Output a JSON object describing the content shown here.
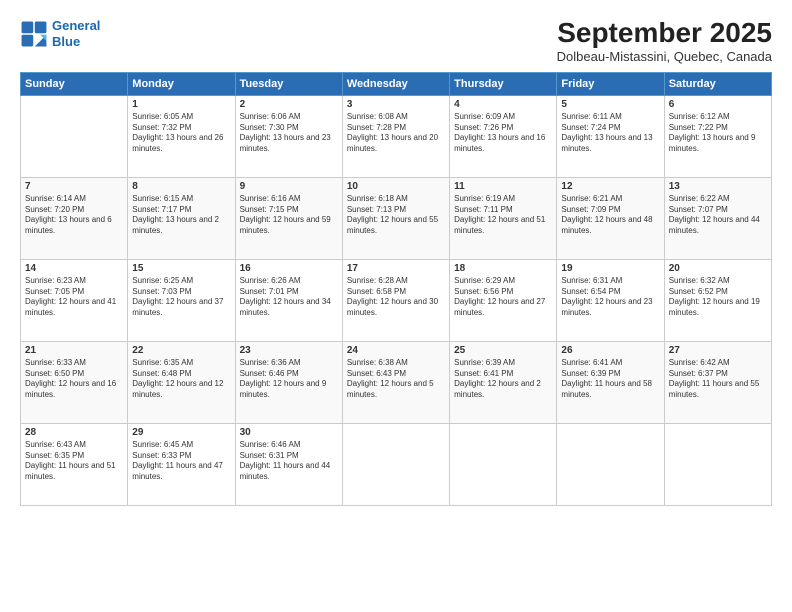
{
  "logo": {
    "line1": "General",
    "line2": "Blue"
  },
  "title": "September 2025",
  "subtitle": "Dolbeau-Mistassini, Quebec, Canada",
  "headers": [
    "Sunday",
    "Monday",
    "Tuesday",
    "Wednesday",
    "Thursday",
    "Friday",
    "Saturday"
  ],
  "weeks": [
    [
      {
        "day": "",
        "sunrise": "",
        "sunset": "",
        "daylight": ""
      },
      {
        "day": "1",
        "sunrise": "Sunrise: 6:05 AM",
        "sunset": "Sunset: 7:32 PM",
        "daylight": "Daylight: 13 hours and 26 minutes."
      },
      {
        "day": "2",
        "sunrise": "Sunrise: 6:06 AM",
        "sunset": "Sunset: 7:30 PM",
        "daylight": "Daylight: 13 hours and 23 minutes."
      },
      {
        "day": "3",
        "sunrise": "Sunrise: 6:08 AM",
        "sunset": "Sunset: 7:28 PM",
        "daylight": "Daylight: 13 hours and 20 minutes."
      },
      {
        "day": "4",
        "sunrise": "Sunrise: 6:09 AM",
        "sunset": "Sunset: 7:26 PM",
        "daylight": "Daylight: 13 hours and 16 minutes."
      },
      {
        "day": "5",
        "sunrise": "Sunrise: 6:11 AM",
        "sunset": "Sunset: 7:24 PM",
        "daylight": "Daylight: 13 hours and 13 minutes."
      },
      {
        "day": "6",
        "sunrise": "Sunrise: 6:12 AM",
        "sunset": "Sunset: 7:22 PM",
        "daylight": "Daylight: 13 hours and 9 minutes."
      }
    ],
    [
      {
        "day": "7",
        "sunrise": "Sunrise: 6:14 AM",
        "sunset": "Sunset: 7:20 PM",
        "daylight": "Daylight: 13 hours and 6 minutes."
      },
      {
        "day": "8",
        "sunrise": "Sunrise: 6:15 AM",
        "sunset": "Sunset: 7:17 PM",
        "daylight": "Daylight: 13 hours and 2 minutes."
      },
      {
        "day": "9",
        "sunrise": "Sunrise: 6:16 AM",
        "sunset": "Sunset: 7:15 PM",
        "daylight": "Daylight: 12 hours and 59 minutes."
      },
      {
        "day": "10",
        "sunrise": "Sunrise: 6:18 AM",
        "sunset": "Sunset: 7:13 PM",
        "daylight": "Daylight: 12 hours and 55 minutes."
      },
      {
        "day": "11",
        "sunrise": "Sunrise: 6:19 AM",
        "sunset": "Sunset: 7:11 PM",
        "daylight": "Daylight: 12 hours and 51 minutes."
      },
      {
        "day": "12",
        "sunrise": "Sunrise: 6:21 AM",
        "sunset": "Sunset: 7:09 PM",
        "daylight": "Daylight: 12 hours and 48 minutes."
      },
      {
        "day": "13",
        "sunrise": "Sunrise: 6:22 AM",
        "sunset": "Sunset: 7:07 PM",
        "daylight": "Daylight: 12 hours and 44 minutes."
      }
    ],
    [
      {
        "day": "14",
        "sunrise": "Sunrise: 6:23 AM",
        "sunset": "Sunset: 7:05 PM",
        "daylight": "Daylight: 12 hours and 41 minutes."
      },
      {
        "day": "15",
        "sunrise": "Sunrise: 6:25 AM",
        "sunset": "Sunset: 7:03 PM",
        "daylight": "Daylight: 12 hours and 37 minutes."
      },
      {
        "day": "16",
        "sunrise": "Sunrise: 6:26 AM",
        "sunset": "Sunset: 7:01 PM",
        "daylight": "Daylight: 12 hours and 34 minutes."
      },
      {
        "day": "17",
        "sunrise": "Sunrise: 6:28 AM",
        "sunset": "Sunset: 6:58 PM",
        "daylight": "Daylight: 12 hours and 30 minutes."
      },
      {
        "day": "18",
        "sunrise": "Sunrise: 6:29 AM",
        "sunset": "Sunset: 6:56 PM",
        "daylight": "Daylight: 12 hours and 27 minutes."
      },
      {
        "day": "19",
        "sunrise": "Sunrise: 6:31 AM",
        "sunset": "Sunset: 6:54 PM",
        "daylight": "Daylight: 12 hours and 23 minutes."
      },
      {
        "day": "20",
        "sunrise": "Sunrise: 6:32 AM",
        "sunset": "Sunset: 6:52 PM",
        "daylight": "Daylight: 12 hours and 19 minutes."
      }
    ],
    [
      {
        "day": "21",
        "sunrise": "Sunrise: 6:33 AM",
        "sunset": "Sunset: 6:50 PM",
        "daylight": "Daylight: 12 hours and 16 minutes."
      },
      {
        "day": "22",
        "sunrise": "Sunrise: 6:35 AM",
        "sunset": "Sunset: 6:48 PM",
        "daylight": "Daylight: 12 hours and 12 minutes."
      },
      {
        "day": "23",
        "sunrise": "Sunrise: 6:36 AM",
        "sunset": "Sunset: 6:46 PM",
        "daylight": "Daylight: 12 hours and 9 minutes."
      },
      {
        "day": "24",
        "sunrise": "Sunrise: 6:38 AM",
        "sunset": "Sunset: 6:43 PM",
        "daylight": "Daylight: 12 hours and 5 minutes."
      },
      {
        "day": "25",
        "sunrise": "Sunrise: 6:39 AM",
        "sunset": "Sunset: 6:41 PM",
        "daylight": "Daylight: 12 hours and 2 minutes."
      },
      {
        "day": "26",
        "sunrise": "Sunrise: 6:41 AM",
        "sunset": "Sunset: 6:39 PM",
        "daylight": "Daylight: 11 hours and 58 minutes."
      },
      {
        "day": "27",
        "sunrise": "Sunrise: 6:42 AM",
        "sunset": "Sunset: 6:37 PM",
        "daylight": "Daylight: 11 hours and 55 minutes."
      }
    ],
    [
      {
        "day": "28",
        "sunrise": "Sunrise: 6:43 AM",
        "sunset": "Sunset: 6:35 PM",
        "daylight": "Daylight: 11 hours and 51 minutes."
      },
      {
        "day": "29",
        "sunrise": "Sunrise: 6:45 AM",
        "sunset": "Sunset: 6:33 PM",
        "daylight": "Daylight: 11 hours and 47 minutes."
      },
      {
        "day": "30",
        "sunrise": "Sunrise: 6:46 AM",
        "sunset": "Sunset: 6:31 PM",
        "daylight": "Daylight: 11 hours and 44 minutes."
      },
      {
        "day": "",
        "sunrise": "",
        "sunset": "",
        "daylight": ""
      },
      {
        "day": "",
        "sunrise": "",
        "sunset": "",
        "daylight": ""
      },
      {
        "day": "",
        "sunrise": "",
        "sunset": "",
        "daylight": ""
      },
      {
        "day": "",
        "sunrise": "",
        "sunset": "",
        "daylight": ""
      }
    ]
  ]
}
